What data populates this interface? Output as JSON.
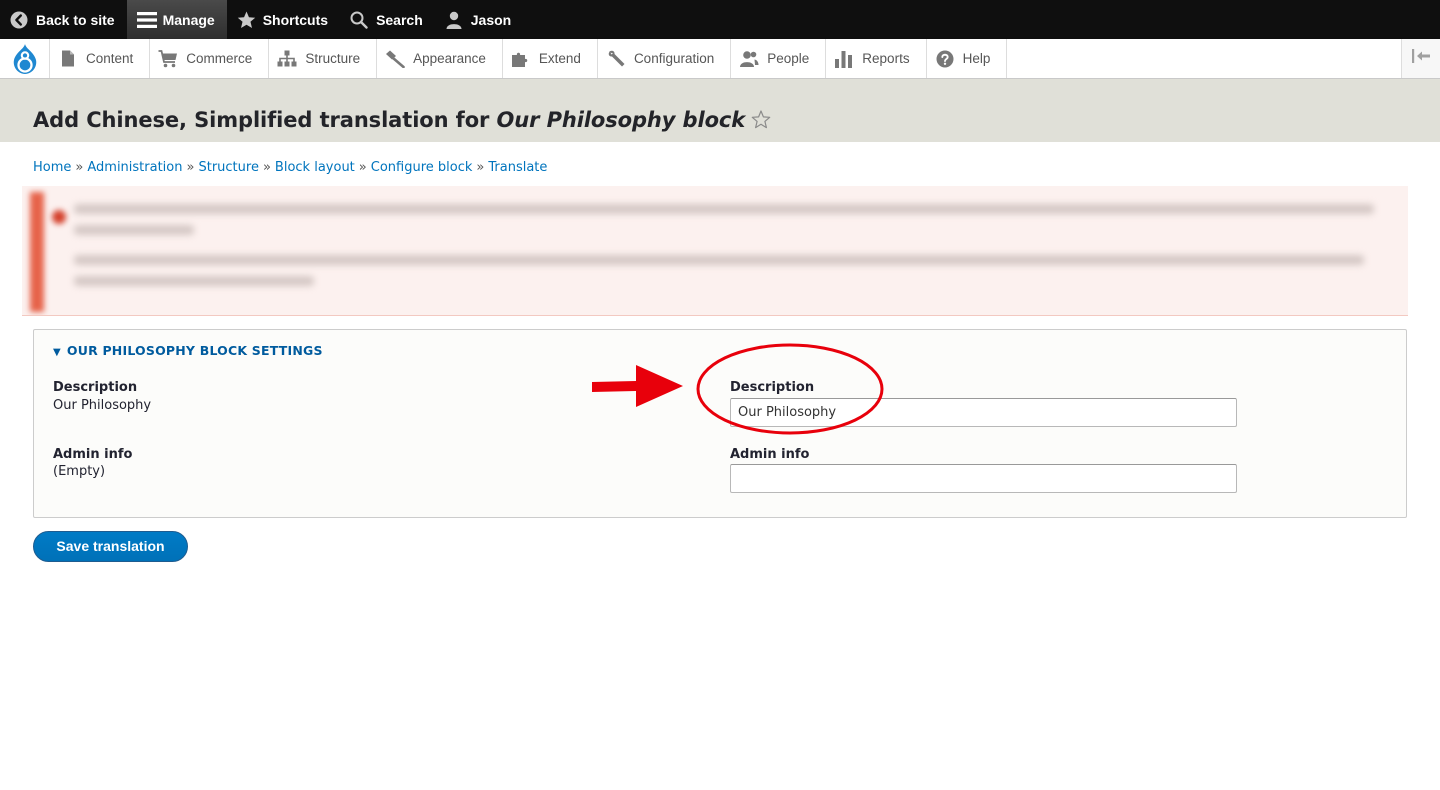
{
  "toolbar": {
    "back_to_site": "Back to site",
    "manage": "Manage",
    "shortcuts": "Shortcuts",
    "search": "Search",
    "user": "Jason"
  },
  "tray": {
    "items": [
      {
        "label": "Content",
        "icon": "document-icon"
      },
      {
        "label": "Commerce",
        "icon": "cart-icon"
      },
      {
        "label": "Structure",
        "icon": "sitemap-icon"
      },
      {
        "label": "Appearance",
        "icon": "brush-icon"
      },
      {
        "label": "Extend",
        "icon": "puzzle-icon"
      },
      {
        "label": "Configuration",
        "icon": "wrench-icon"
      },
      {
        "label": "People",
        "icon": "people-icon"
      },
      {
        "label": "Reports",
        "icon": "bar-chart-icon"
      },
      {
        "label": "Help",
        "icon": "help-icon"
      }
    ]
  },
  "page": {
    "title_prefix": "Add Chinese, Simplified translation for ",
    "title_entity": "Our Philosophy block"
  },
  "breadcrumb": {
    "items": [
      "Home",
      "Administration",
      "Structure",
      "Block layout",
      "Configure block",
      "Translate"
    ],
    "separator": "»"
  },
  "form": {
    "section_title": "OUR PHILOSOPHY BLOCK SETTINGS",
    "source": {
      "description_label": "Description",
      "description_value": "Our Philosophy",
      "admin_info_label": "Admin info",
      "admin_info_value": "(Empty)"
    },
    "translation": {
      "description_label": "Description",
      "description_value": "Our Philosophy",
      "admin_info_label": "Admin info",
      "admin_info_value": ""
    },
    "save_label": "Save translation"
  },
  "colors": {
    "link": "#0074bd",
    "primary_button": "#0071b8",
    "annotation": "#e8000b",
    "header_bg": "#e0e0d8"
  }
}
